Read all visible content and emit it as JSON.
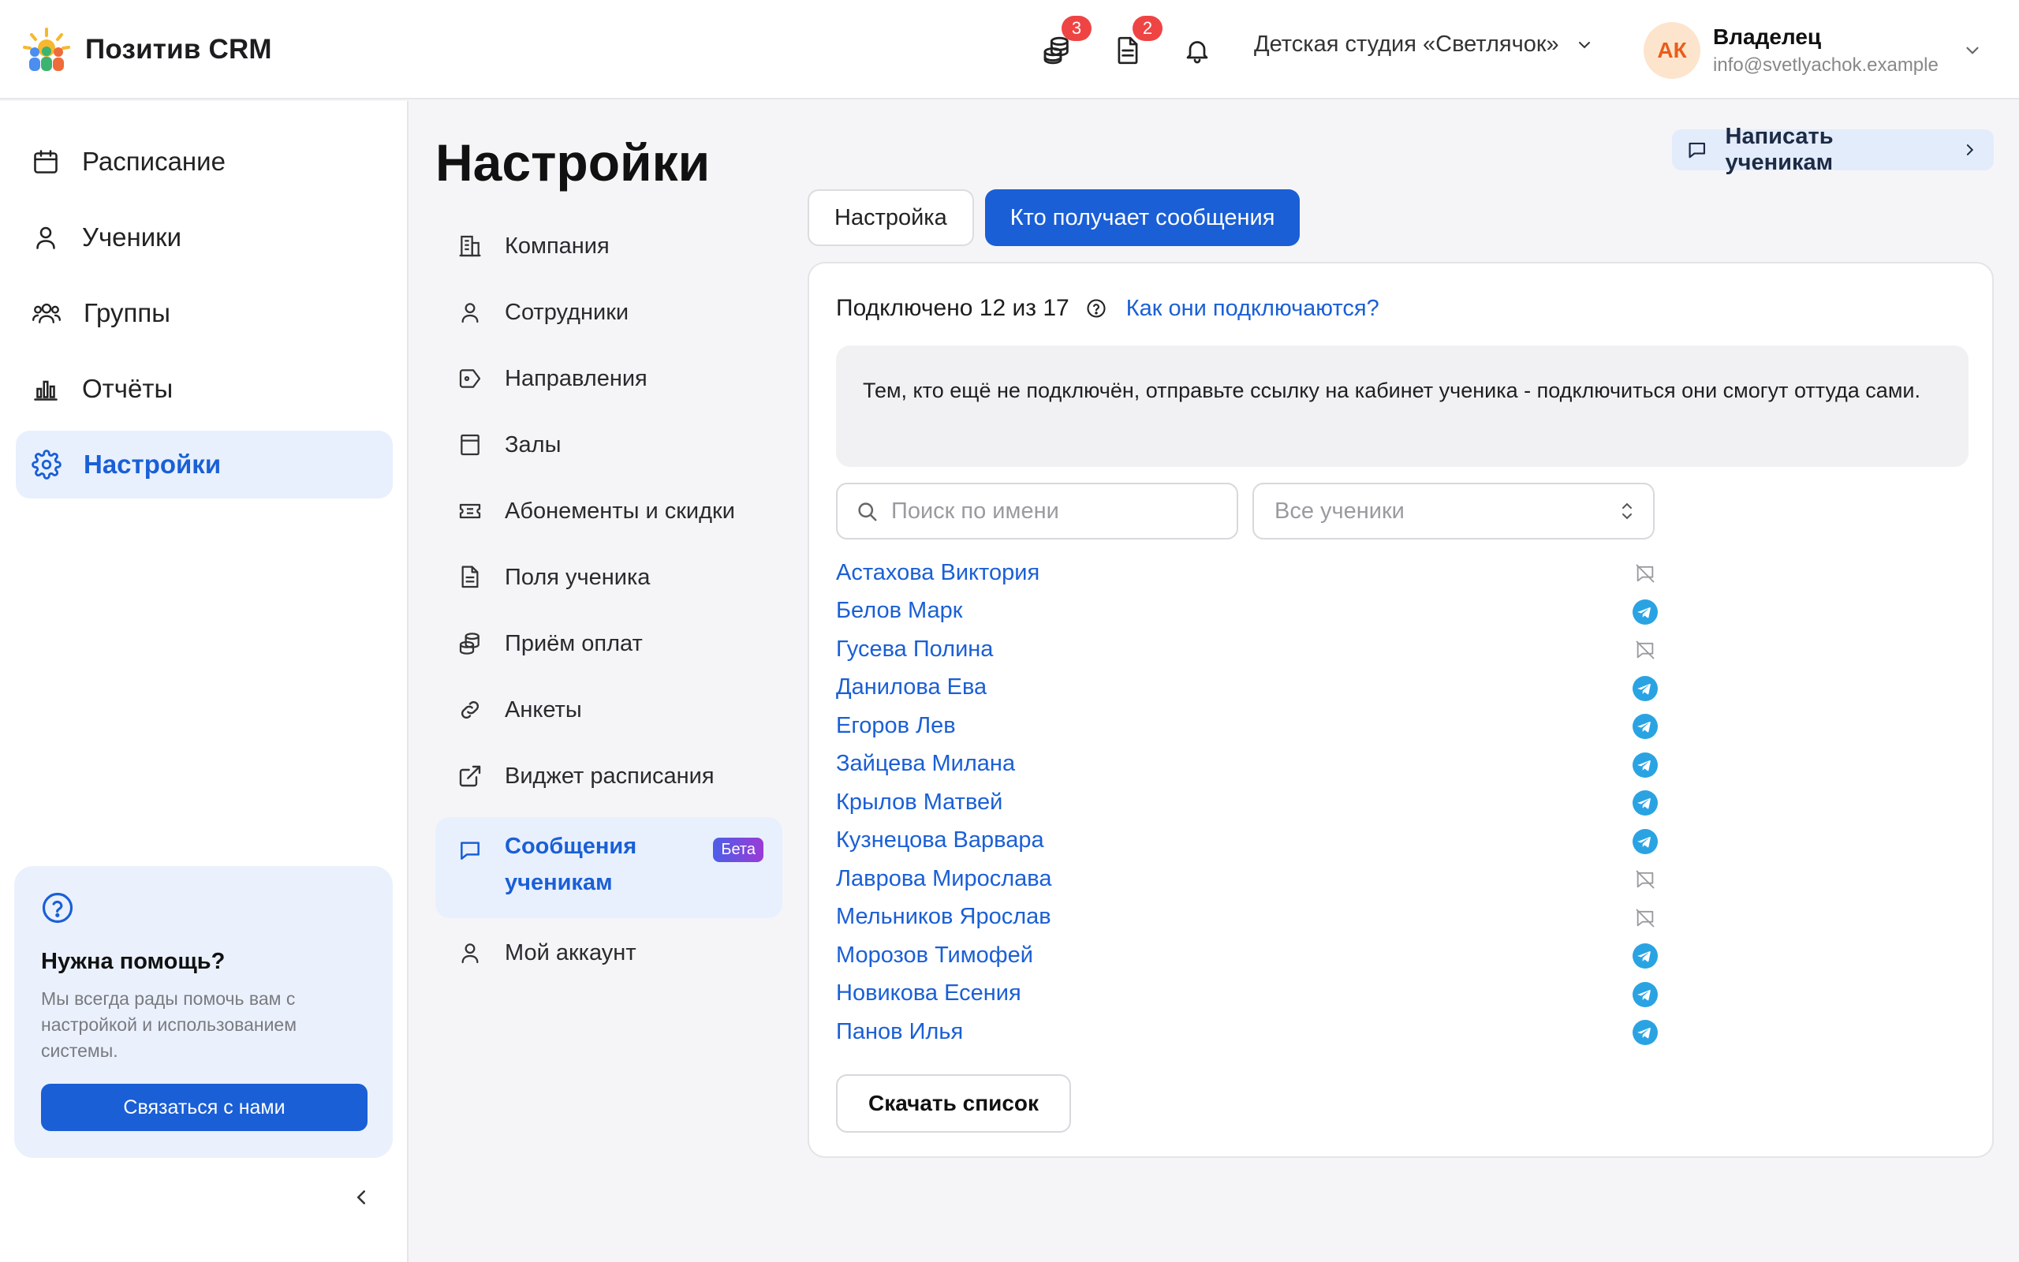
{
  "app": {
    "name": "Позитив CRM"
  },
  "header": {
    "payments_badge": "3",
    "documents_badge": "2",
    "studio": "Детская студия «Светлячок»",
    "user": {
      "initials": "АК",
      "role": "Владелец",
      "email": "info@svetlyachok.example"
    }
  },
  "sidebar": {
    "items": [
      {
        "label": "Расписание",
        "icon": "calendar-icon"
      },
      {
        "label": "Ученики",
        "icon": "user-icon"
      },
      {
        "label": "Группы",
        "icon": "users-icon"
      },
      {
        "label": "Отчёты",
        "icon": "chart-icon"
      },
      {
        "label": "Настройки",
        "icon": "gear-icon",
        "active": true
      }
    ],
    "help": {
      "title": "Нужна помощь?",
      "text": "Мы всегда рады помочь вам с настройкой и использованием системы.",
      "button": "Связаться с нами"
    }
  },
  "page": {
    "title": "Настройки",
    "write_button": "Написать ученикам"
  },
  "settings_nav": [
    {
      "label": "Компания",
      "icon": "building-icon"
    },
    {
      "label": "Сотрудники",
      "icon": "user-icon"
    },
    {
      "label": "Направления",
      "icon": "tag-icon"
    },
    {
      "label": "Залы",
      "icon": "room-icon"
    },
    {
      "label": "Абонементы и скидки",
      "icon": "ticket-icon"
    },
    {
      "label": "Поля ученика",
      "icon": "document-icon"
    },
    {
      "label": "Приём оплат",
      "icon": "coins-icon"
    },
    {
      "label": "Анкеты",
      "icon": "link-icon"
    },
    {
      "label": "Виджет расписания",
      "icon": "external-link-icon"
    },
    {
      "label": "Сообщения ученикам",
      "icon": "chat-icon",
      "badge": "Бета",
      "active": true
    },
    {
      "label": "Мой аккаунт",
      "icon": "user-icon"
    }
  ],
  "tabs": [
    {
      "label": "Настройка",
      "active": false
    },
    {
      "label": "Кто получает сообщения",
      "active": true
    }
  ],
  "panel": {
    "connected": "Подключено 12 из 17",
    "how_link": "Как они подключаются?",
    "notice": "Тем, кто ещё не подключён, отправьте ссылку на кабинет ученика - подключиться они смогут оттуда сами.",
    "search_placeholder": "Поиск по имени",
    "filter_value": "Все ученики",
    "download_button": "Скачать список"
  },
  "students": [
    {
      "name": "Астахова Виктория",
      "connected": false
    },
    {
      "name": "Белов Марк",
      "connected": true
    },
    {
      "name": "Гусева Полина",
      "connected": false
    },
    {
      "name": "Данилова Ева",
      "connected": true
    },
    {
      "name": "Егоров Лев",
      "connected": true
    },
    {
      "name": "Зайцева Милана",
      "connected": true
    },
    {
      "name": "Крылов Матвей",
      "connected": true
    },
    {
      "name": "Кузнецова Варвара",
      "connected": true
    },
    {
      "name": "Лаврова Мирослава",
      "connected": false
    },
    {
      "name": "Мельников Ярослав",
      "connected": false
    },
    {
      "name": "Морозов Тимофей",
      "connected": true
    },
    {
      "name": "Новикова Есения",
      "connected": true
    },
    {
      "name": "Панов Илья",
      "connected": true
    }
  ],
  "colors": {
    "accent": "#1a5fd6",
    "telegram": "#2aa3e3",
    "badge": "#ef4444",
    "active_bg": "#e8f0fe"
  }
}
